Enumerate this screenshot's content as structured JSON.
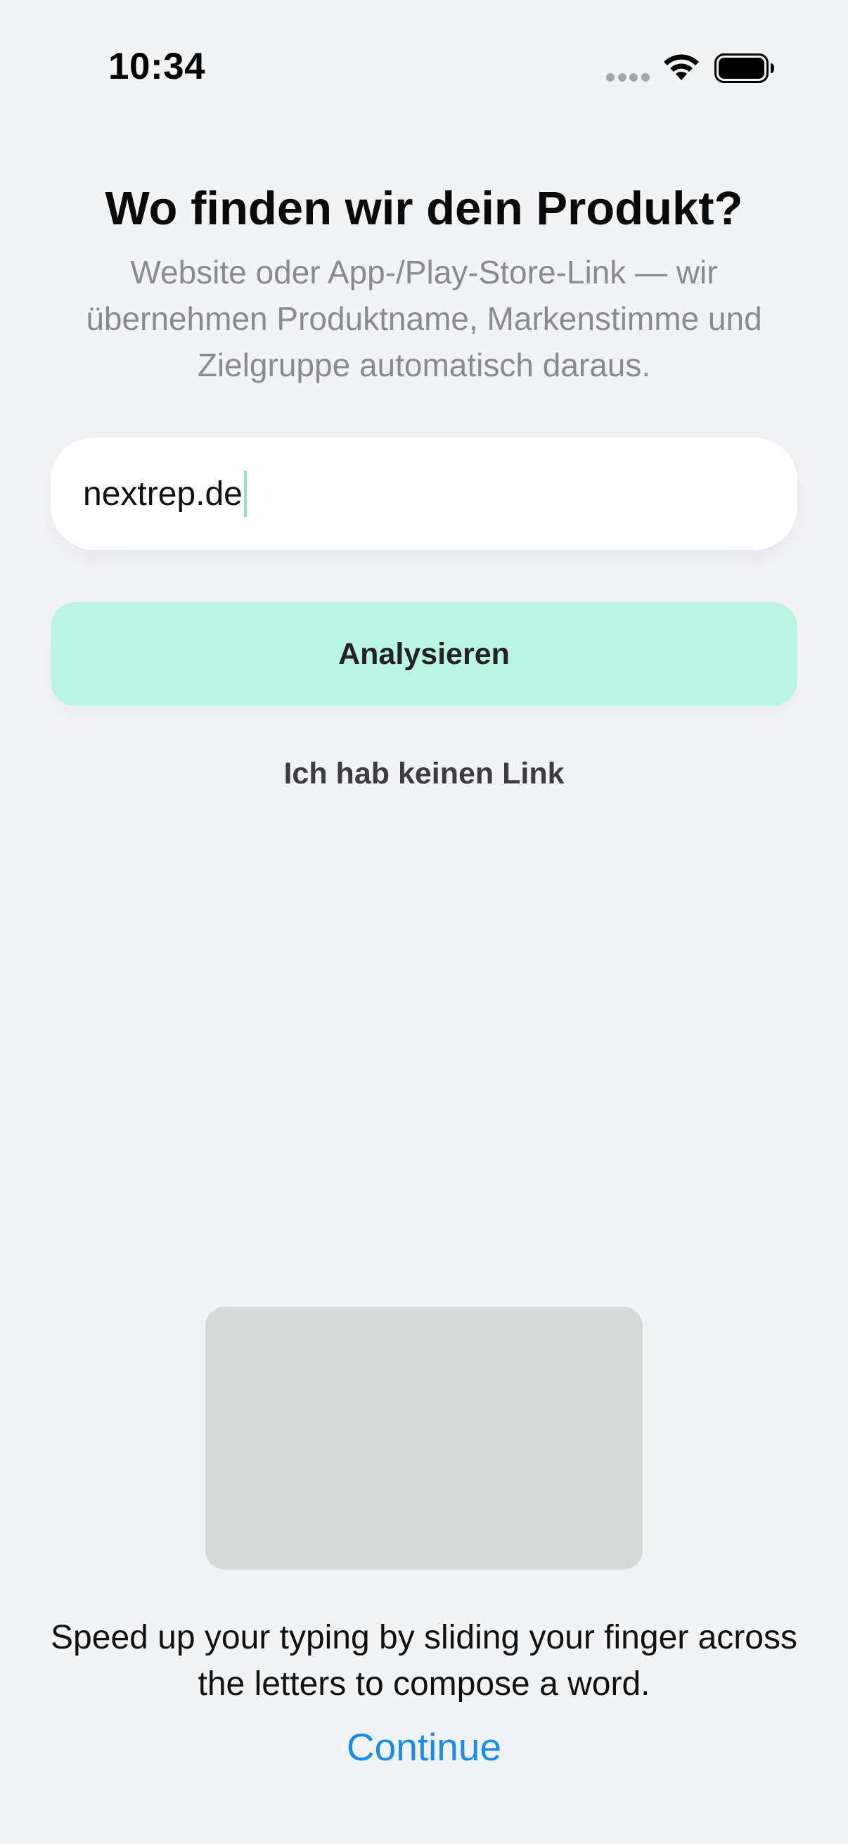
{
  "status_bar": {
    "time": "10:34",
    "icons": [
      "cellular-signal-icon",
      "wifi-icon",
      "battery-icon"
    ]
  },
  "onboarding": {
    "title": "Wo finden wir dein Produkt?",
    "subtitle": "Website oder App-/Play-Store-Link — wir übernehmen Produktname, Markenstimme und Zielgruppe automatisch daraus.",
    "url_input": {
      "value": "nextrep.de",
      "placeholder": ""
    },
    "analyze_label": "Analysieren",
    "no_link_label": "Ich hab keinen Link"
  },
  "keyboard_tip": {
    "text": "Speed up your typing by sliding your finger across the letters to compose a word.",
    "continue_label": "Continue"
  },
  "colors": {
    "background": "#f2f3f5",
    "accent_mint": "#b9f5e2",
    "caret": "#8fe6c6",
    "link_blue": "#1a8cf0",
    "subtitle_gray": "#8a8b90"
  }
}
